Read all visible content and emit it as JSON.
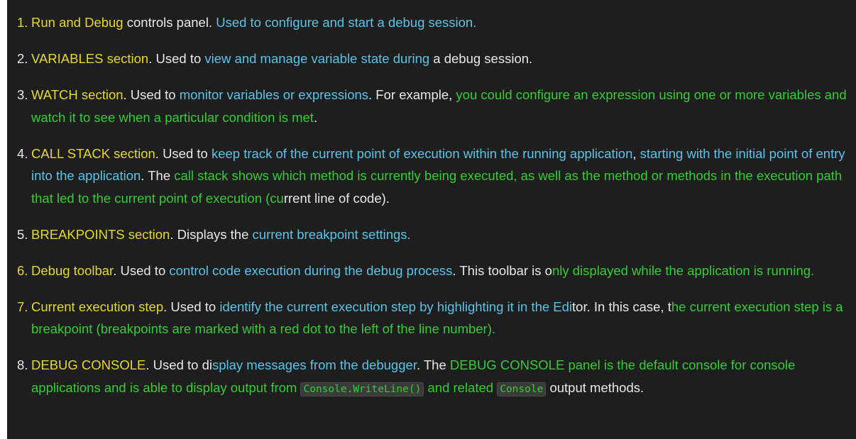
{
  "items": [
    {
      "num": "1.",
      "num_color": "yellow",
      "segments": [
        {
          "text": "Run and Debug",
          "color": "yellow"
        },
        {
          "text": " controls panel. ",
          "color": "white"
        },
        {
          "text": "Used to configure and start a debug session.",
          "color": "blue"
        }
      ]
    },
    {
      "num": "2.",
      "num_color": "white",
      "segments": [
        {
          "text": "VARIABLES section",
          "color": "yellow"
        },
        {
          "text": ". Used to ",
          "color": "white"
        },
        {
          "text": "view and manage variable state during",
          "color": "blue"
        },
        {
          "text": " a debug session.",
          "color": "white"
        }
      ]
    },
    {
      "num": "3.",
      "num_color": "white",
      "segments": [
        {
          "text": "WATCH section",
          "color": "yellow"
        },
        {
          "text": ". Used to ",
          "color": "white"
        },
        {
          "text": "monitor variables or expressions",
          "color": "blue"
        },
        {
          "text": ". For example, ",
          "color": "white"
        },
        {
          "text": "you could configure an expression using one or more variables and watch it to see when a particular condition is met",
          "color": "green"
        },
        {
          "text": ".",
          "color": "white"
        }
      ]
    },
    {
      "num": "4.",
      "num_color": "white",
      "segments": [
        {
          "text": "CALL STACK section",
          "color": "yellow"
        },
        {
          "text": ". Used to ",
          "color": "white"
        },
        {
          "text": "keep track of the current point of execution within the running application",
          "color": "blue"
        },
        {
          "text": ", ",
          "color": "white"
        },
        {
          "text": "starting with the initial point of entry into the application",
          "color": "blue"
        },
        {
          "text": ". The ",
          "color": "white"
        },
        {
          "text": "call stack shows which method is currently being executed, as well as the method or methods in the execution path that led to the current point of execution (cu",
          "color": "green"
        },
        {
          "text": "rrent line of code).",
          "color": "white"
        }
      ]
    },
    {
      "num": "5.",
      "num_color": "white",
      "segments": [
        {
          "text": "BREAKPOINTS section",
          "color": "yellow"
        },
        {
          "text": ". Displays the ",
          "color": "white"
        },
        {
          "text": "current breakpoint settings.",
          "color": "blue"
        }
      ]
    },
    {
      "num": "6.",
      "num_color": "yellow",
      "segments": [
        {
          "text": "Debug toolbar",
          "color": "yellow"
        },
        {
          "text": ". Used to ",
          "color": "white"
        },
        {
          "text": "control code execution during the debug process",
          "color": "blue"
        },
        {
          "text": ". This toolbar is o",
          "color": "white"
        },
        {
          "text": "nly displayed while the application is running.",
          "color": "green"
        }
      ]
    },
    {
      "num": "7.",
      "num_color": "yellow",
      "segments": [
        {
          "text": "Current execution step",
          "color": "yellow"
        },
        {
          "text": ". Used to ",
          "color": "white"
        },
        {
          "text": "identify the current execution step by highlighting it in the Edi",
          "color": "blue"
        },
        {
          "text": "tor. In this case, t",
          "color": "white"
        },
        {
          "text": "he current execution step is a breakpoint (breakpoints are marked with a red dot to the left of the line number).",
          "color": "green"
        }
      ]
    },
    {
      "num": "8.",
      "num_color": "white",
      "segments": [
        {
          "text": "DEBUG CONSOLE",
          "color": "yellow"
        },
        {
          "text": ". Used to di",
          "color": "white"
        },
        {
          "text": "splay messages from the debugger",
          "color": "blue"
        },
        {
          "text": ". The ",
          "color": "white"
        },
        {
          "text": "DEBUG CONSOLE panel is the default console for conso",
          "color": "green"
        },
        {
          "text": "le applications and is able to display output from ",
          "color": "green"
        },
        {
          "text": "Console.WriteLine()",
          "color": "green",
          "code": true
        },
        {
          "text": " and related ",
          "color": "green"
        },
        {
          "text": "Console",
          "color": "green",
          "code": true
        },
        {
          "text": " output methods.",
          "color": "white"
        }
      ]
    }
  ]
}
